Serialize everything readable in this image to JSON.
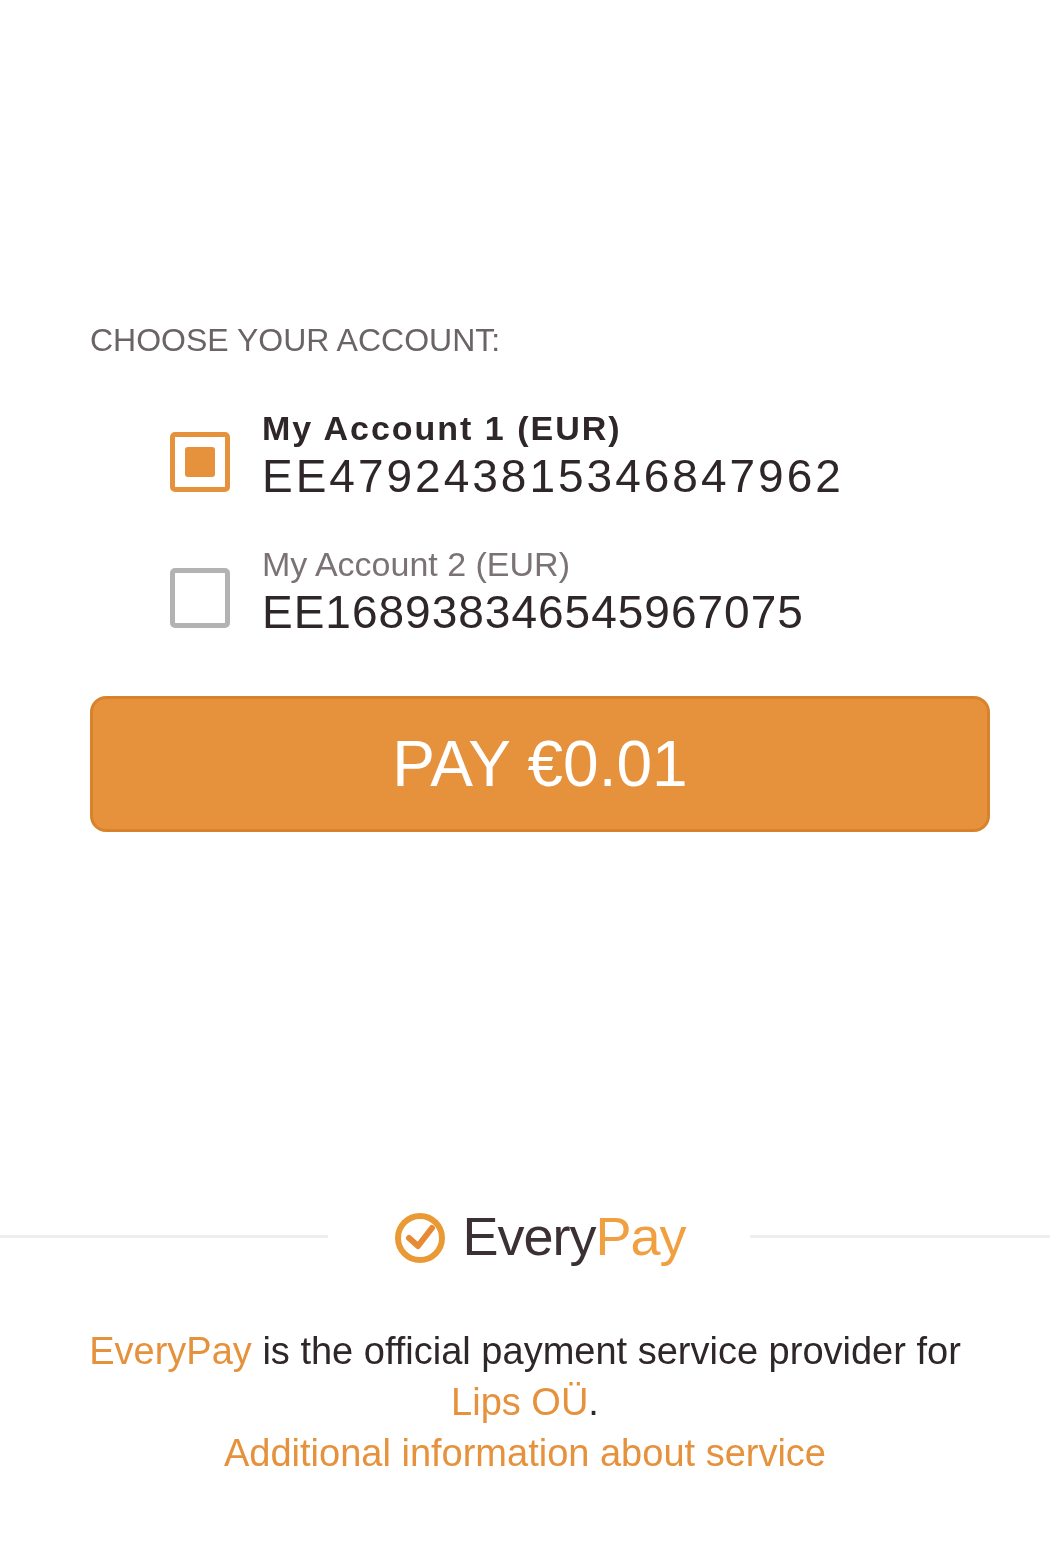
{
  "heading": "CHOOSE YOUR ACCOUNT:",
  "accounts": [
    {
      "name": "My Account 1 (EUR)",
      "iban": "EE479243815346847962",
      "selected": true
    },
    {
      "name": "My Account 2 (EUR)",
      "iban": "EE168938346545967075",
      "selected": false
    }
  ],
  "pay_button": "PAY €0.01",
  "logo": {
    "first": "Every",
    "second": "Pay"
  },
  "footer": {
    "parts": [
      {
        "kind": "link",
        "text": "EveryPay"
      },
      {
        "kind": "text",
        "text": " is the official payment service provider for "
      },
      {
        "kind": "link",
        "text": "Lips OÜ"
      },
      {
        "kind": "text",
        "text": "."
      }
    ],
    "info_link": "Additional information about service"
  }
}
